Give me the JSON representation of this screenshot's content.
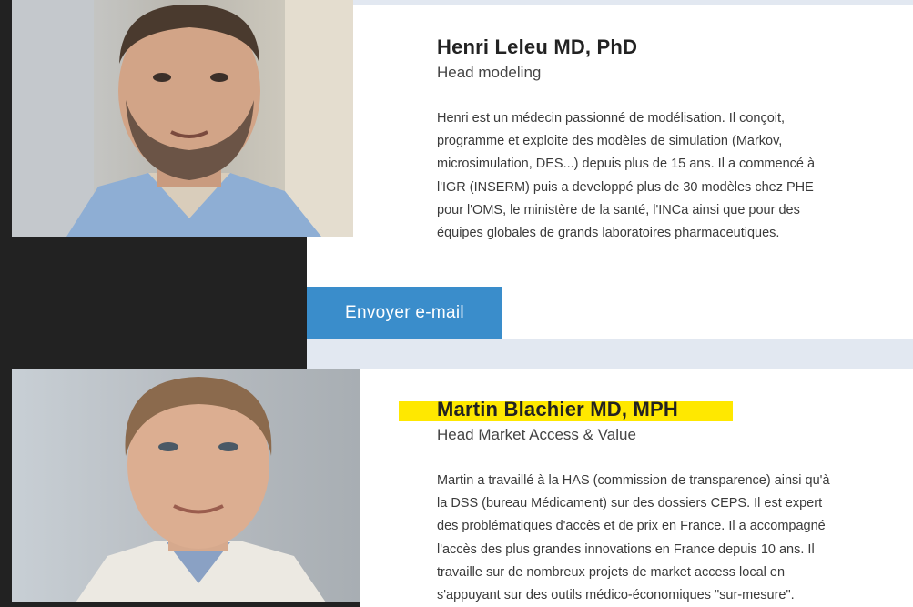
{
  "people": [
    {
      "name": "Henri Leleu MD, PhD",
      "role": "Head modeling",
      "bio_lines": [
        "Henri est un médecin passionné de modélisation. Il conçoit,",
        "programme et exploite des modèles de simulation (Markov,",
        "microsimulation, DES...) depuis plus de 15 ans. Il a commencé à",
        "l'IGR (INSERM) puis a developpé plus de 30 modèles chez PHE",
        "pour l'OMS, le ministère de la santé, l'INCa ainsi que pour des",
        "équipes globales de grands laboratoires pharmaceutiques."
      ],
      "email_button": "Envoyer e-mail"
    },
    {
      "name": "Martin Blachier MD, MPH",
      "role": "Head Market Access & Value",
      "bio_lines": [
        "Martin a travaillé à la HAS (commission de transparence) ainsi qu'à",
        "la DSS (bureau Médicament) sur des dossiers CEPS. Il est expert",
        "des problématiques d'accès et de prix en France. Il a accompagné",
        "l'accès des plus grandes innovations en France depuis 10 ans. Il",
        "travaille sur de nombreux projets de market access local en",
        "s'appuyant sur des outils médico-économiques \"sur-mesure\"."
      ]
    }
  ],
  "colors": {
    "dark_panel": "#222222",
    "button": "#3a8dcb",
    "band": "#e2e8f1",
    "highlight": "#ffe800"
  }
}
